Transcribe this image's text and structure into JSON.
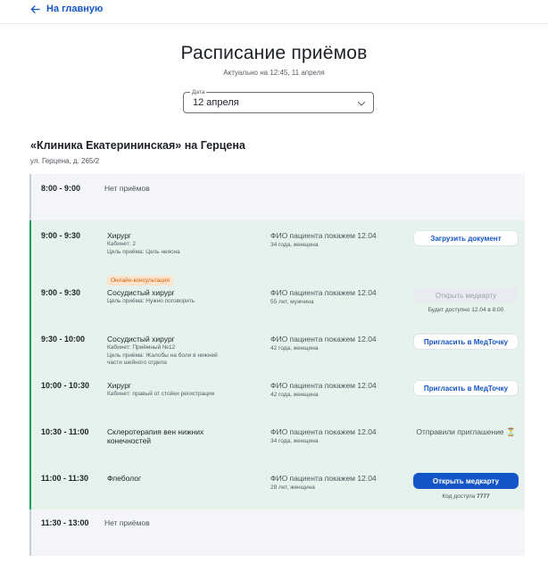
{
  "nav": {
    "back_label": "На главную"
  },
  "header": {
    "title": "Расписание приёмов",
    "subtitle": "Актуально на 12:45, 11 апреля"
  },
  "date_field": {
    "legend": "Дата",
    "value": "12 апреля"
  },
  "clinic": {
    "name": "«Клиника Екатерининская» на Герцена",
    "address": "ул. Герцена, д. 265/2"
  },
  "empty_slots": [
    {
      "time": "8:00 - 9:00",
      "text": "Нет приёмов"
    },
    {
      "time": "11:30 - 13:00",
      "text": "Нет приёмов"
    }
  ],
  "appointments": [
    {
      "time": "9:00 - 9:30",
      "service": "Хирург",
      "details": "Кабинет: 2\nЦель приёма: Цель неясна",
      "patient": "ФИО пациента покажем 12.04",
      "patient_info": "34 года, женщина",
      "action": "Загрузить документ"
    },
    {
      "time": "9:00 - 9:30",
      "badge": "Онлайн-консультация",
      "service": "Сосудистый хирург",
      "details": "Цель приёма: Нужно поговорить",
      "patient": "ФИО пациента покажем 12.04",
      "patient_info": "55 лет, мужчина",
      "action": "Открыть медкарту",
      "action_note": "Будет доступно 12.04 в 8:00"
    },
    {
      "time": "9:30 - 10:00",
      "service": "Сосудистый хирург",
      "details": "Кабинет: Приёмный №12\nЦель приёма: Жалобы на боли в нижней части шейного отдела",
      "patient": "ФИО пациента покажем 12.04",
      "patient_info": "42 года, женщина",
      "action": "Пригласить в МедТочку"
    },
    {
      "time": "10:00 - 10:30",
      "service": "Хирург",
      "details": "Кабинет: правый от стойки регистрации",
      "patient": "ФИО пациента покажем 12.04",
      "patient_info": "42 года, женщина",
      "action": "Пригласить в МедТочку"
    },
    {
      "time": "10:30 - 11:00",
      "service": "Склеротерапия вен нижних конечностей",
      "patient": "ФИО пациента покажем 12.04",
      "patient_info": "34 года, женщина",
      "status": "Отправили приглашение ⏳"
    },
    {
      "time": "11:00 - 11:30",
      "service": "Флеболог",
      "patient": "ФИО пациента покажем 12.04",
      "patient_info": "28 лет, женщина",
      "action": "Открыть медкарту",
      "access_label": "Код доступа",
      "access_code": "7777"
    }
  ],
  "colors": {
    "accent": "#1456c8",
    "busy_bg": "#e5f3ec",
    "busy_border": "#13a05a",
    "empty_bg": "#f3f5f8",
    "badge_bg": "#fde3c9",
    "badge_text": "#c86413"
  },
  "icons": {
    "back": "arrow-left-icon",
    "date_dropdown": "chevron-down-icon",
    "pending": "hourglass-icon"
  }
}
